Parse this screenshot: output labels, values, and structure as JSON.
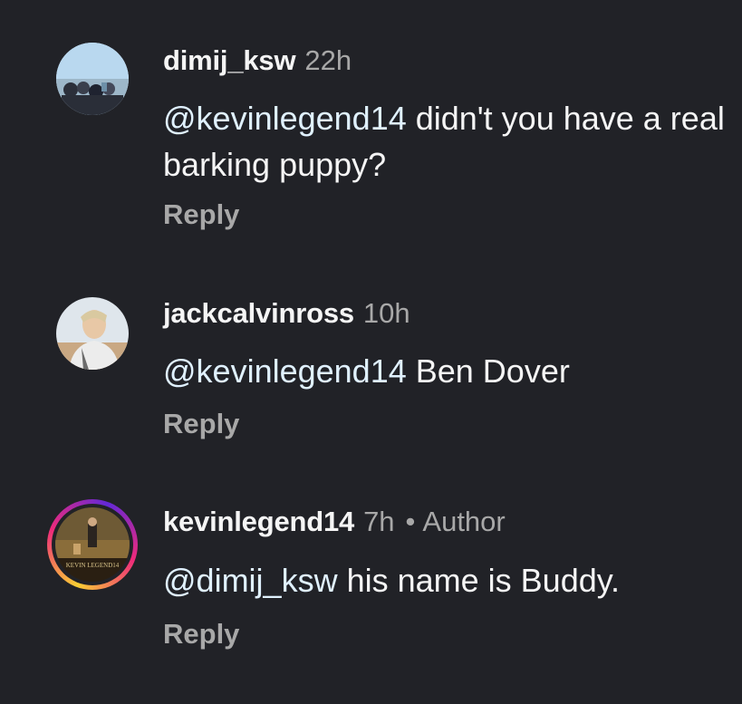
{
  "comments": [
    {
      "username": "dimij_ksw",
      "time": "22h",
      "mention": "@kevinlegend14",
      "text": " didn't you have a real barking puppy?",
      "reply_label": "Reply"
    },
    {
      "username": "jackcalvinross",
      "time": "10h",
      "mention": "@kevinlegend14",
      "text": " Ben Dover",
      "reply_label": "Reply"
    },
    {
      "username": "kevinlegend14",
      "time": "7h",
      "separator": "•",
      "badge": "Author",
      "mention": "@dimij_ksw",
      "text": " his name is Buddy.",
      "reply_label": "Reply",
      "avatar_logo_text": "KEVIN LEGEND14"
    }
  ],
  "colors": {
    "background": "#212227",
    "text": "#f5f5f5",
    "muted": "#a8a8a8",
    "mention": "#e0f1ff"
  }
}
